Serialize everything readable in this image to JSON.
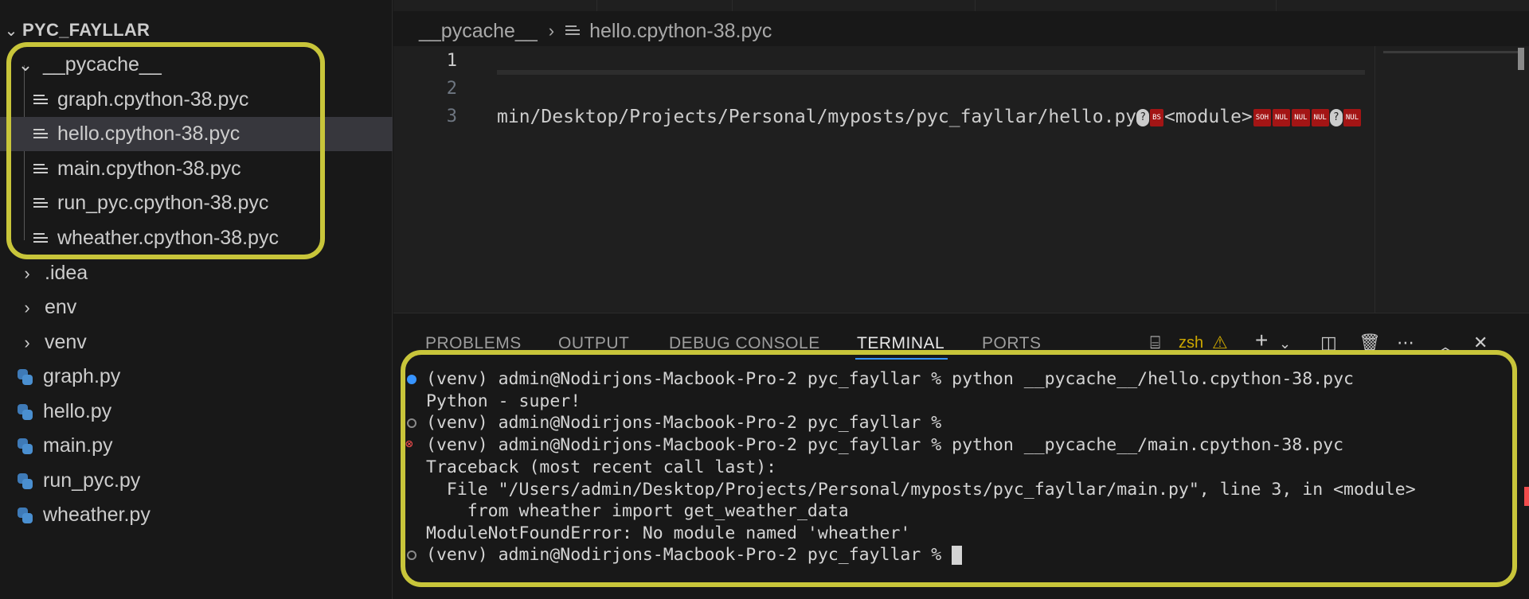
{
  "explorer": {
    "root_label": "PYC_FAYLLAR",
    "items": [
      {
        "label": "__pycache__",
        "type": "folder",
        "expanded": true
      },
      {
        "label": "graph.cpython-38.pyc",
        "type": "file"
      },
      {
        "label": "hello.cpython-38.pyc",
        "type": "file",
        "selected": true
      },
      {
        "label": "main.cpython-38.pyc",
        "type": "file"
      },
      {
        "label": "run_pyc.cpython-38.pyc",
        "type": "file"
      },
      {
        "label": "wheather.cpython-38.pyc",
        "type": "file"
      },
      {
        "label": ".idea",
        "type": "folder"
      },
      {
        "label": "env",
        "type": "folder"
      },
      {
        "label": "venv",
        "type": "folder"
      },
      {
        "label": "graph.py",
        "type": "python"
      },
      {
        "label": "hello.py",
        "type": "python"
      },
      {
        "label": "main.py",
        "type": "python"
      },
      {
        "label": "run_pyc.py",
        "type": "python"
      },
      {
        "label": "wheather.py",
        "type": "python"
      }
    ]
  },
  "breadcrumb": {
    "folder": "__pycache__",
    "file": "hello.cpython-38.pyc"
  },
  "editor": {
    "line_numbers": [
      "1",
      "2",
      "3"
    ],
    "line3_path": "min/Desktop/Projects/Personal/myposts/pyc_fayllar/hello.py",
    "line3_module": "<module>",
    "ctl_bs": "BS",
    "ctl_soh": "SOH",
    "ctl_nul": "NUL",
    "qmark": "?"
  },
  "panel": {
    "tabs": [
      "PROBLEMS",
      "OUTPUT",
      "DEBUG CONSOLE",
      "TERMINAL",
      "PORTS"
    ],
    "active_tab": "TERMINAL",
    "shell_label": "zsh",
    "warning_icon": "warning-icon",
    "tool_icons": [
      "terminal-icon",
      "add-icon",
      "dropdown-icon",
      "split-icon",
      "trash-icon",
      "more-icon",
      "maximize-icon",
      "close-icon"
    ]
  },
  "terminal": {
    "lines": [
      "(venv) admin@Nodirjons-Macbook-Pro-2 pyc_fayllar % python __pycache__/hello.cpython-38.pyc",
      "Python - super!",
      "(venv) admin@Nodirjons-Macbook-Pro-2 pyc_fayllar %",
      "(venv) admin@Nodirjons-Macbook-Pro-2 pyc_fayllar % python __pycache__/main.cpython-38.pyc",
      "Traceback (most recent call last):",
      "  File \"/Users/admin/Desktop/Projects/Personal/myposts/pyc_fayllar/main.py\", line 3, in <module>",
      "    from wheather import get_weather_data",
      "ModuleNotFoundError: No module named 'wheather'",
      "(venv) admin@Nodirjons-Macbook-Pro-2 pyc_fayllar % "
    ]
  },
  "colors": {
    "highlight": "#c8c53a",
    "accent": "#3794ff",
    "error": "#f14c4c",
    "control_char_bg": "#a31515"
  }
}
